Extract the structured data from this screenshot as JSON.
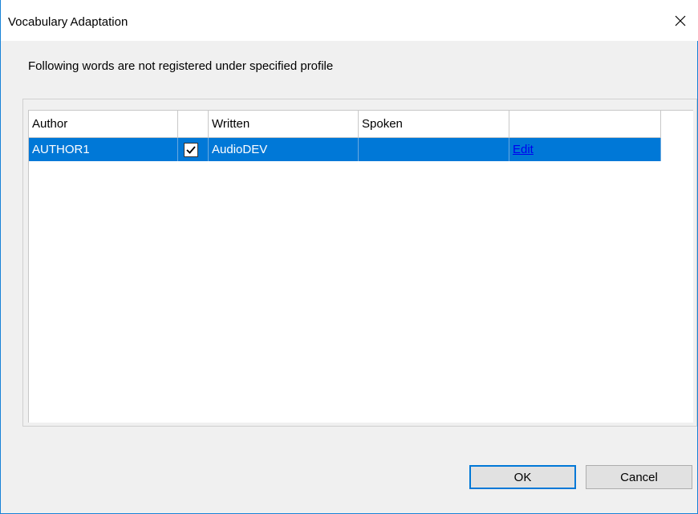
{
  "window": {
    "title": "Vocabulary Adaptation",
    "close_icon": "close-icon"
  },
  "message": "Following words are not registered under specified profile",
  "table": {
    "columns": [
      "Author",
      "",
      "Written",
      "Spoken",
      ""
    ],
    "rows": [
      {
        "author": "AUTHOR1",
        "checked": true,
        "written": "AudioDEV",
        "spoken": "",
        "action": "Edit",
        "selected": true
      }
    ]
  },
  "buttons": {
    "ok": "OK",
    "cancel": "Cancel"
  },
  "colors": {
    "selection": "#0078d7",
    "window_border": "#1883d7",
    "link": "#0000ee"
  }
}
